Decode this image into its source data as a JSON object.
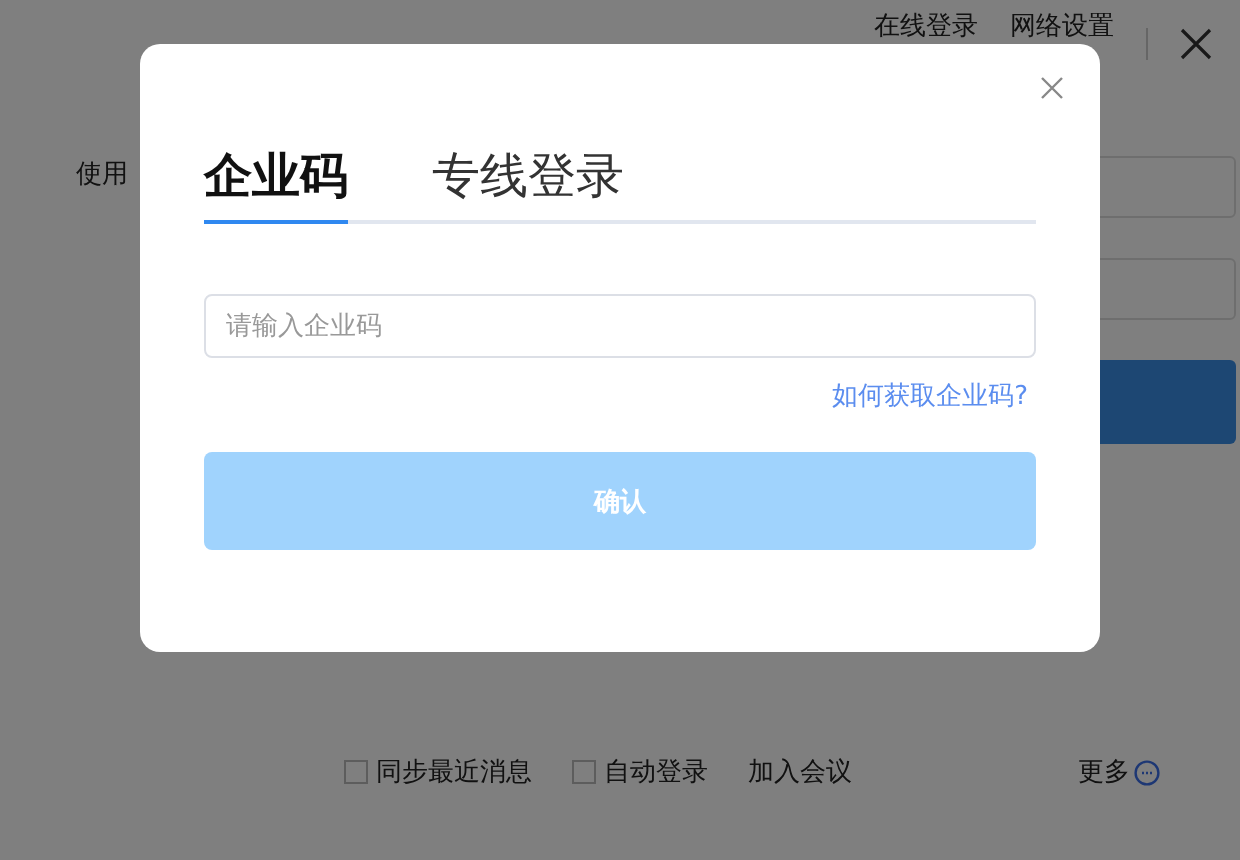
{
  "background": {
    "top_links": [
      "在线登录",
      "网络设置"
    ],
    "side_text": "使用",
    "options": [
      {
        "kind": "checkbox",
        "label": "同步最近消息",
        "checked": false
      },
      {
        "kind": "checkbox",
        "label": "自动登录",
        "checked": false
      },
      {
        "kind": "link",
        "label": "加入会议"
      }
    ],
    "more": "更多"
  },
  "dialog": {
    "tabs": [
      {
        "label": "企业码",
        "selected": true
      },
      {
        "label": "专线登录",
        "selected": false
      }
    ],
    "field": {
      "placeholder": "请输入企业码"
    },
    "help_link": "如何获取企业码?",
    "confirm": {
      "label": "确认",
      "disabled": true
    }
  }
}
